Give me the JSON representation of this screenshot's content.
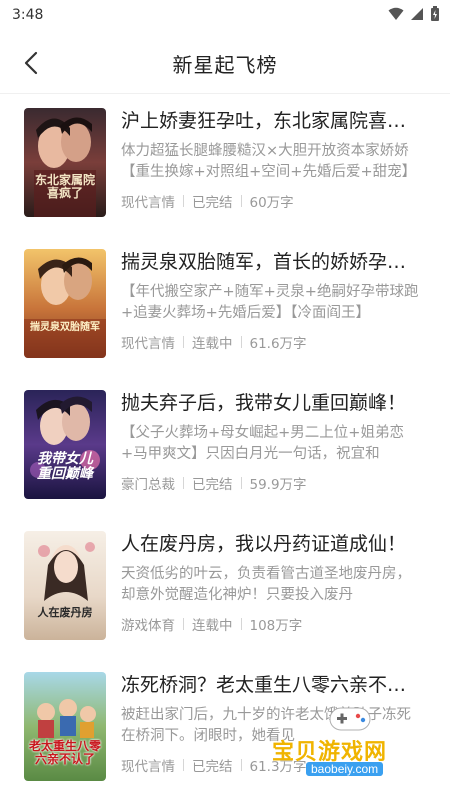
{
  "status_bar": {
    "time": "3:48"
  },
  "nav": {
    "title": "新星起飞榜"
  },
  "books": [
    {
      "title": "沪上娇妻狂孕吐，东北家属院喜疯了",
      "description": "体力超猛长腿蜂腰糙汉×大胆开放资本家娇娇【重生换嫁+对照组+空间+先婚后爱+甜宠】",
      "genre": "现代言情",
      "status": "已完结",
      "word_count": "60万字",
      "cover_text": "东北家属院\n喜疯了"
    },
    {
      "title": "揣灵泉双胎随军，首长的娇娇孕妻撩疯了",
      "description": "【年代搬空家产+随军+灵泉+绝嗣好孕带球跑+追妻火葬场+先婚后爱】【冷面阎王】",
      "genre": "现代言情",
      "status": "连载中",
      "word_count": "61.6万字",
      "cover_text": "揣灵泉双胎随军"
    },
    {
      "title": "抛夫弃子后，我带女儿重回巅峰！",
      "description": "【父子火葬场+母女崛起+男二上位+姐弟恋+马甲爽文】只因白月光一句话，祝宜和",
      "genre": "豪门总裁",
      "status": "已完结",
      "word_count": "59.9万字",
      "cover_text": "我带女儿\n重回巅峰"
    },
    {
      "title": "人在废丹房，我以丹药证道成仙！",
      "description": "天资低劣的叶云，负责看管古道圣地废丹房，却意外觉醒造化神炉！只要投入废丹",
      "genre": "游戏体育",
      "status": "连载中",
      "word_count": "108万字",
      "cover_text": "人在废丹房"
    },
    {
      "title": "冻死桥洞？老太重生八零六亲不认了",
      "description": "被赶出家门后，九十岁的许老太饿着肚子冻死在桥洞下。闭眼时，她看见",
      "genre": "现代言情",
      "status": "已完结",
      "word_count": "61.3万字",
      "cover_text": "老太重生八零\n六亲不认了"
    }
  ],
  "watermark": {
    "main": "宝贝游戏网",
    "sub": "baobeiy.com"
  },
  "colors": {
    "title": "#222222",
    "secondary": "#999999",
    "watermark": "#f0b400"
  }
}
